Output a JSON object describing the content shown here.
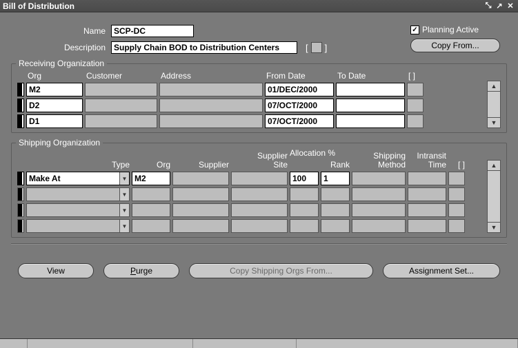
{
  "window": {
    "title": "Bill of Distribution"
  },
  "header": {
    "name_label": "Name",
    "name_value": "SCP-DC",
    "desc_label": "Description",
    "desc_value": "Supply Chain BOD to Distribution Centers",
    "planning_active_label": "Planning Active",
    "planning_active_checked": true,
    "copy_from_label": "Copy From..."
  },
  "receiving": {
    "legend": "Receiving Organization",
    "headers": {
      "org": "Org",
      "customer": "Customer",
      "address": "Address",
      "from": "From Date",
      "to": "To Date",
      "flag": "[  ]"
    },
    "rows": [
      {
        "org": "M2",
        "customer": "",
        "address": "",
        "from": "01/DEC/2000",
        "to": "",
        "flag": ""
      },
      {
        "org": "D2",
        "customer": "",
        "address": "",
        "from": "07/OCT/2000",
        "to": "",
        "flag": ""
      },
      {
        "org": "D1",
        "customer": "",
        "address": "",
        "from": "07/OCT/2000",
        "to": "",
        "flag": ""
      }
    ]
  },
  "shipping": {
    "legend": "Shipping Organization",
    "headers": {
      "type": "Type",
      "org": "Org",
      "supplier": "Supplier",
      "supplier_site_1": "Supplier",
      "supplier_site_2": "Site",
      "alloc": "Allocation %",
      "rank": "Rank",
      "ship_method_1": "Shipping",
      "ship_method_2": "Method",
      "intransit_1": "Intransit",
      "intransit_2": "Time",
      "flag": "[  ]"
    },
    "rows": [
      {
        "type": "Make At",
        "org": "M2",
        "supplier": "",
        "site": "",
        "alloc": "100",
        "rank": "1",
        "method": "",
        "time": "",
        "flag": ""
      },
      {
        "type": "",
        "org": "",
        "supplier": "",
        "site": "",
        "alloc": "",
        "rank": "",
        "method": "",
        "time": "",
        "flag": ""
      },
      {
        "type": "",
        "org": "",
        "supplier": "",
        "site": "",
        "alloc": "",
        "rank": "",
        "method": "",
        "time": "",
        "flag": ""
      },
      {
        "type": "",
        "org": "",
        "supplier": "",
        "site": "",
        "alloc": "",
        "rank": "",
        "method": "",
        "time": "",
        "flag": ""
      }
    ]
  },
  "buttons": {
    "view": "View",
    "purge": "Purge",
    "copy_ship": "Copy Shipping Orgs From...",
    "assign_set": "Assignment Set..."
  }
}
